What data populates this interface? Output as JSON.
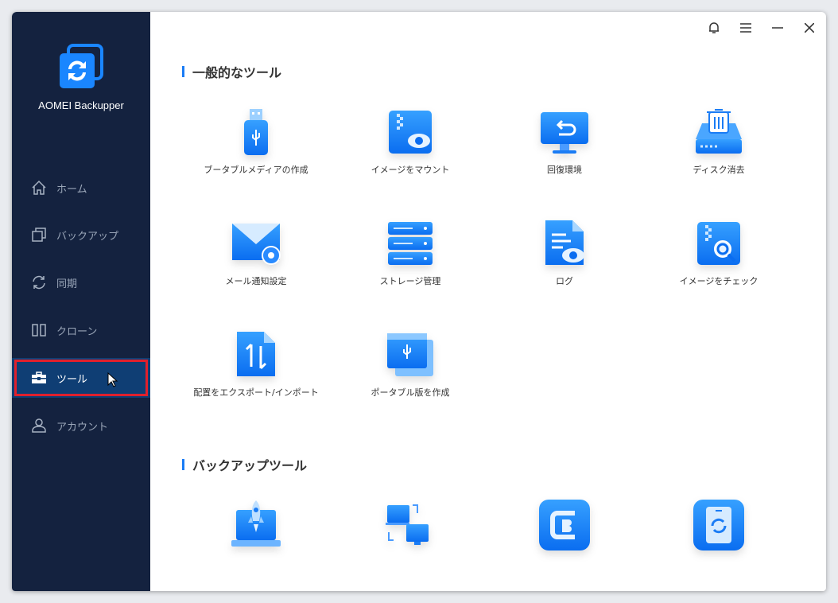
{
  "app": {
    "name": "AOMEI Backupper"
  },
  "sidebar": {
    "items": [
      {
        "label": "ホーム",
        "icon": "home-icon"
      },
      {
        "label": "バックアップ",
        "icon": "backup-icon"
      },
      {
        "label": "同期",
        "icon": "sync-icon"
      },
      {
        "label": "クローン",
        "icon": "clone-icon"
      },
      {
        "label": "ツール",
        "icon": "toolbox-icon",
        "active": true
      },
      {
        "label": "アカウント",
        "icon": "account-icon"
      }
    ]
  },
  "titlebar": {
    "buttons": [
      "bell-icon",
      "menu-icon",
      "minimize-icon",
      "close-icon"
    ]
  },
  "sections": [
    {
      "title": "一般的なツール",
      "tools": [
        {
          "label": "ブータブルメディアの作成",
          "icon": "usb-icon"
        },
        {
          "label": "イメージをマウント",
          "icon": "mount-image-icon"
        },
        {
          "label": "回復環境",
          "icon": "recovery-env-icon"
        },
        {
          "label": "ディスク消去",
          "icon": "disk-wipe-icon"
        },
        {
          "label": "メール通知設定",
          "icon": "mail-settings-icon"
        },
        {
          "label": "ストレージ管理",
          "icon": "storage-icon"
        },
        {
          "label": "ログ",
          "icon": "log-icon"
        },
        {
          "label": "イメージをチェック",
          "icon": "check-image-icon"
        },
        {
          "label": "配置をエクスポート/インポート",
          "icon": "export-import-icon"
        },
        {
          "label": "ポータブル版を作成",
          "icon": "portable-icon"
        }
      ]
    },
    {
      "title": "バックアップツール",
      "tools": [
        {
          "icon": "rocket-laptop-icon"
        },
        {
          "icon": "image-transfer-icon"
        },
        {
          "icon": "cbackupper-icon"
        },
        {
          "icon": "phone-sync-icon"
        }
      ]
    }
  ],
  "colors": {
    "sidebar": "#14223f",
    "active": "#0f3e74",
    "accent": "#1a7cf5",
    "highlight": "#e0202c"
  }
}
